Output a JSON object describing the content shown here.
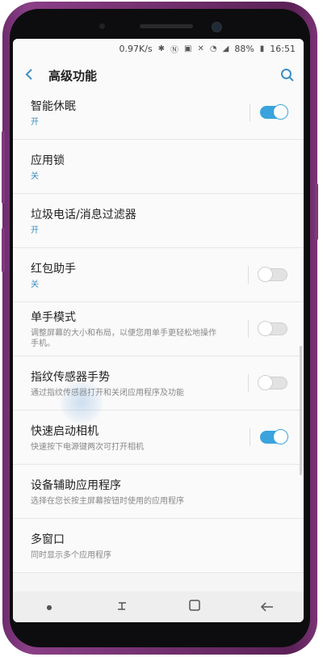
{
  "status": {
    "speed": "0.97K/s",
    "battery": "88%",
    "time": "16:51"
  },
  "header": {
    "title": "高级功能"
  },
  "rows": [
    {
      "title": "智能休眠",
      "sub": "开",
      "toggle": "on"
    },
    {
      "title": "应用锁",
      "sub": "关"
    },
    {
      "title": "垃圾电话/消息过滤器",
      "sub": "开"
    },
    {
      "title": "红包助手",
      "sub": "关",
      "toggle": "off"
    },
    {
      "title": "单手模式",
      "sub": "调整屏幕的大小和布局，以便您用单手更轻松地操作手机。",
      "toggle": "off"
    },
    {
      "title": "指纹传感器手势",
      "sub": "通过指纹传感器打开和关闭应用程序及功能",
      "toggle": "off"
    },
    {
      "title": "快速启动相机",
      "sub": "快速按下电源键两次可打开相机",
      "toggle": "on"
    },
    {
      "title": "设备辅助应用程序",
      "sub": "选择在您长按主屏幕按钮时使用的应用程序"
    },
    {
      "title": "多窗口",
      "sub": "同时显示多个应用程序"
    }
  ],
  "colors": {
    "accent": "#3b8fc7",
    "toggle_on": "#3aa3dd",
    "phone_frame": "#7e3a7a"
  },
  "icons": {
    "back": "back-arrow-icon",
    "search": "search-icon",
    "nav_recent": "recent-apps-icon",
    "nav_home": "home-icon",
    "nav_back": "nav-back-icon"
  }
}
